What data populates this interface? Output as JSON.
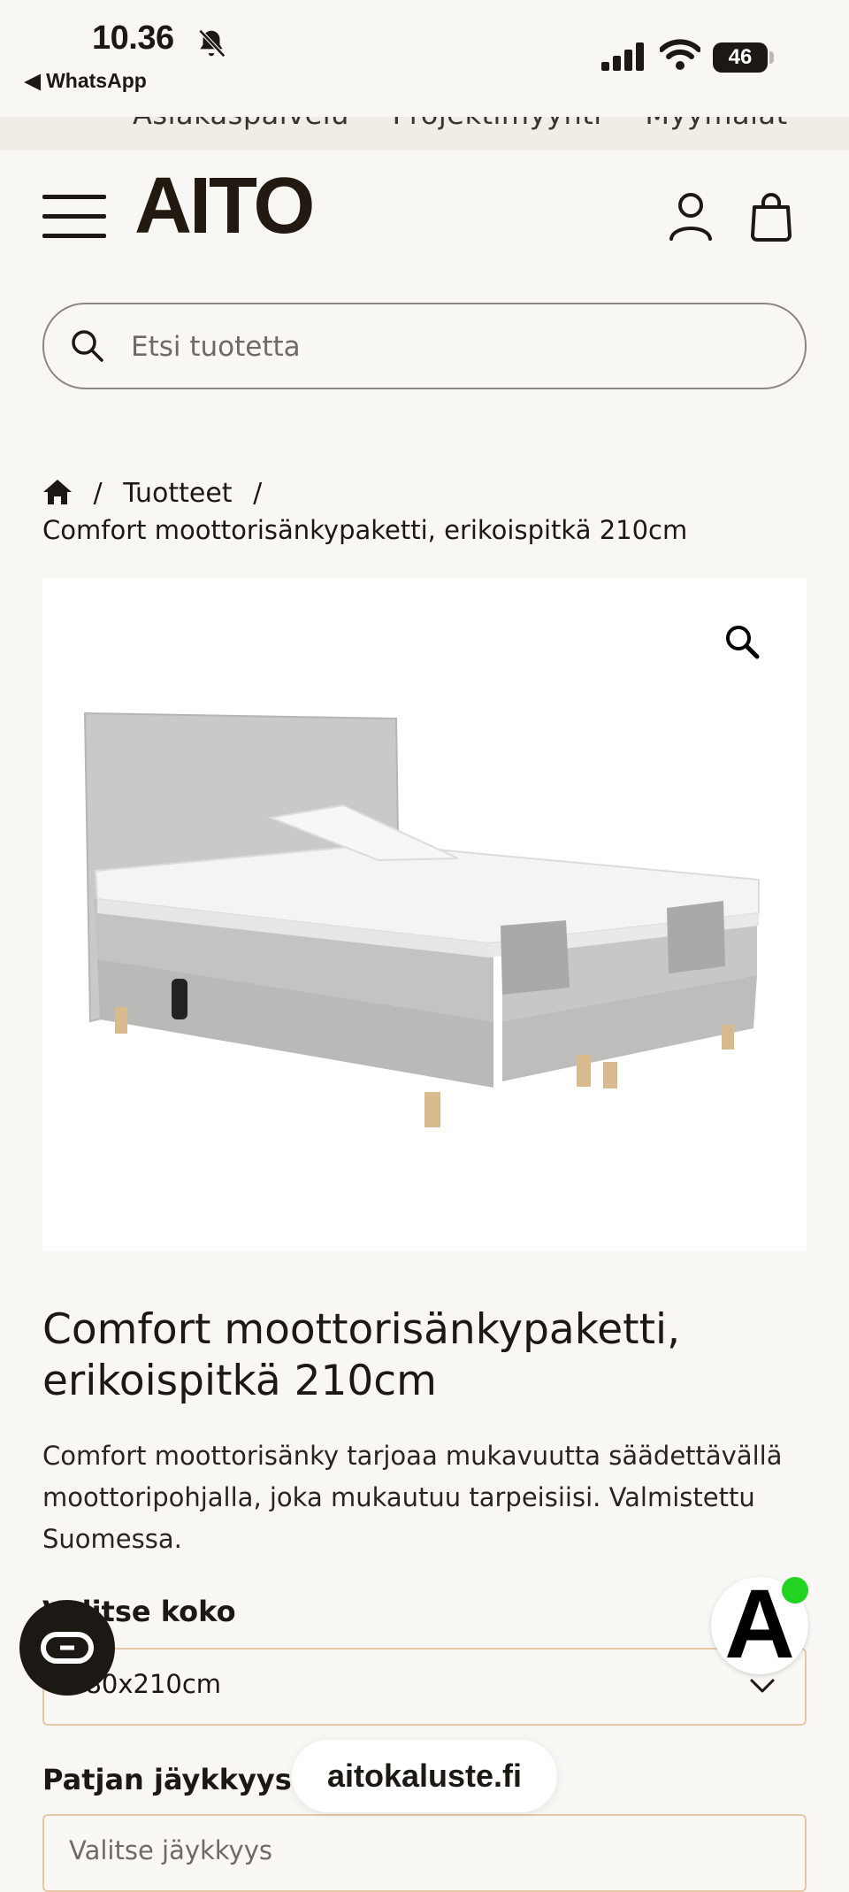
{
  "status_bar": {
    "time": "10.36",
    "back_app": "◀ WhatsApp",
    "battery": "46"
  },
  "top_links": [
    "Asiakaspalvelu",
    "Projektimyynti",
    "Myymälät"
  ],
  "header": {
    "logo": "AITO"
  },
  "search": {
    "placeholder": "Etsi tuotetta"
  },
  "breadcrumb": {
    "items": [
      "Tuotteet"
    ],
    "separator": "/",
    "current": "Comfort moottorisänkypaketti, erikoispitkä 210cm"
  },
  "product": {
    "title": "Comfort moottorisänkypaketti, erikoispitkä 210cm",
    "description": "Comfort moottorisänky tarjoaa mukavuutta säädettävällä moottoripohjalla, joka mukautuu tarpeisiisi. Valmistettu Suomessa.",
    "size_label": "Valitse koko",
    "size_value": "180x210cm",
    "firmness_label": "Patjan jäykkyys",
    "firmness_value": "Valitse jäykkyys"
  },
  "floating": {
    "badge_letter": "A",
    "url": "aitokaluste.fi"
  },
  "colors": {
    "background": "#f9f7f4",
    "text": "#1c1814",
    "select_border": "#e7c7a5",
    "online": "#22d322"
  },
  "icons": [
    "bell-off-icon",
    "signal-icon",
    "wifi-icon",
    "battery-icon",
    "menu-icon",
    "user-icon",
    "bag-icon",
    "search-icon",
    "home-icon",
    "zoom-icon",
    "chevron-down-icon",
    "chat-icon"
  ]
}
